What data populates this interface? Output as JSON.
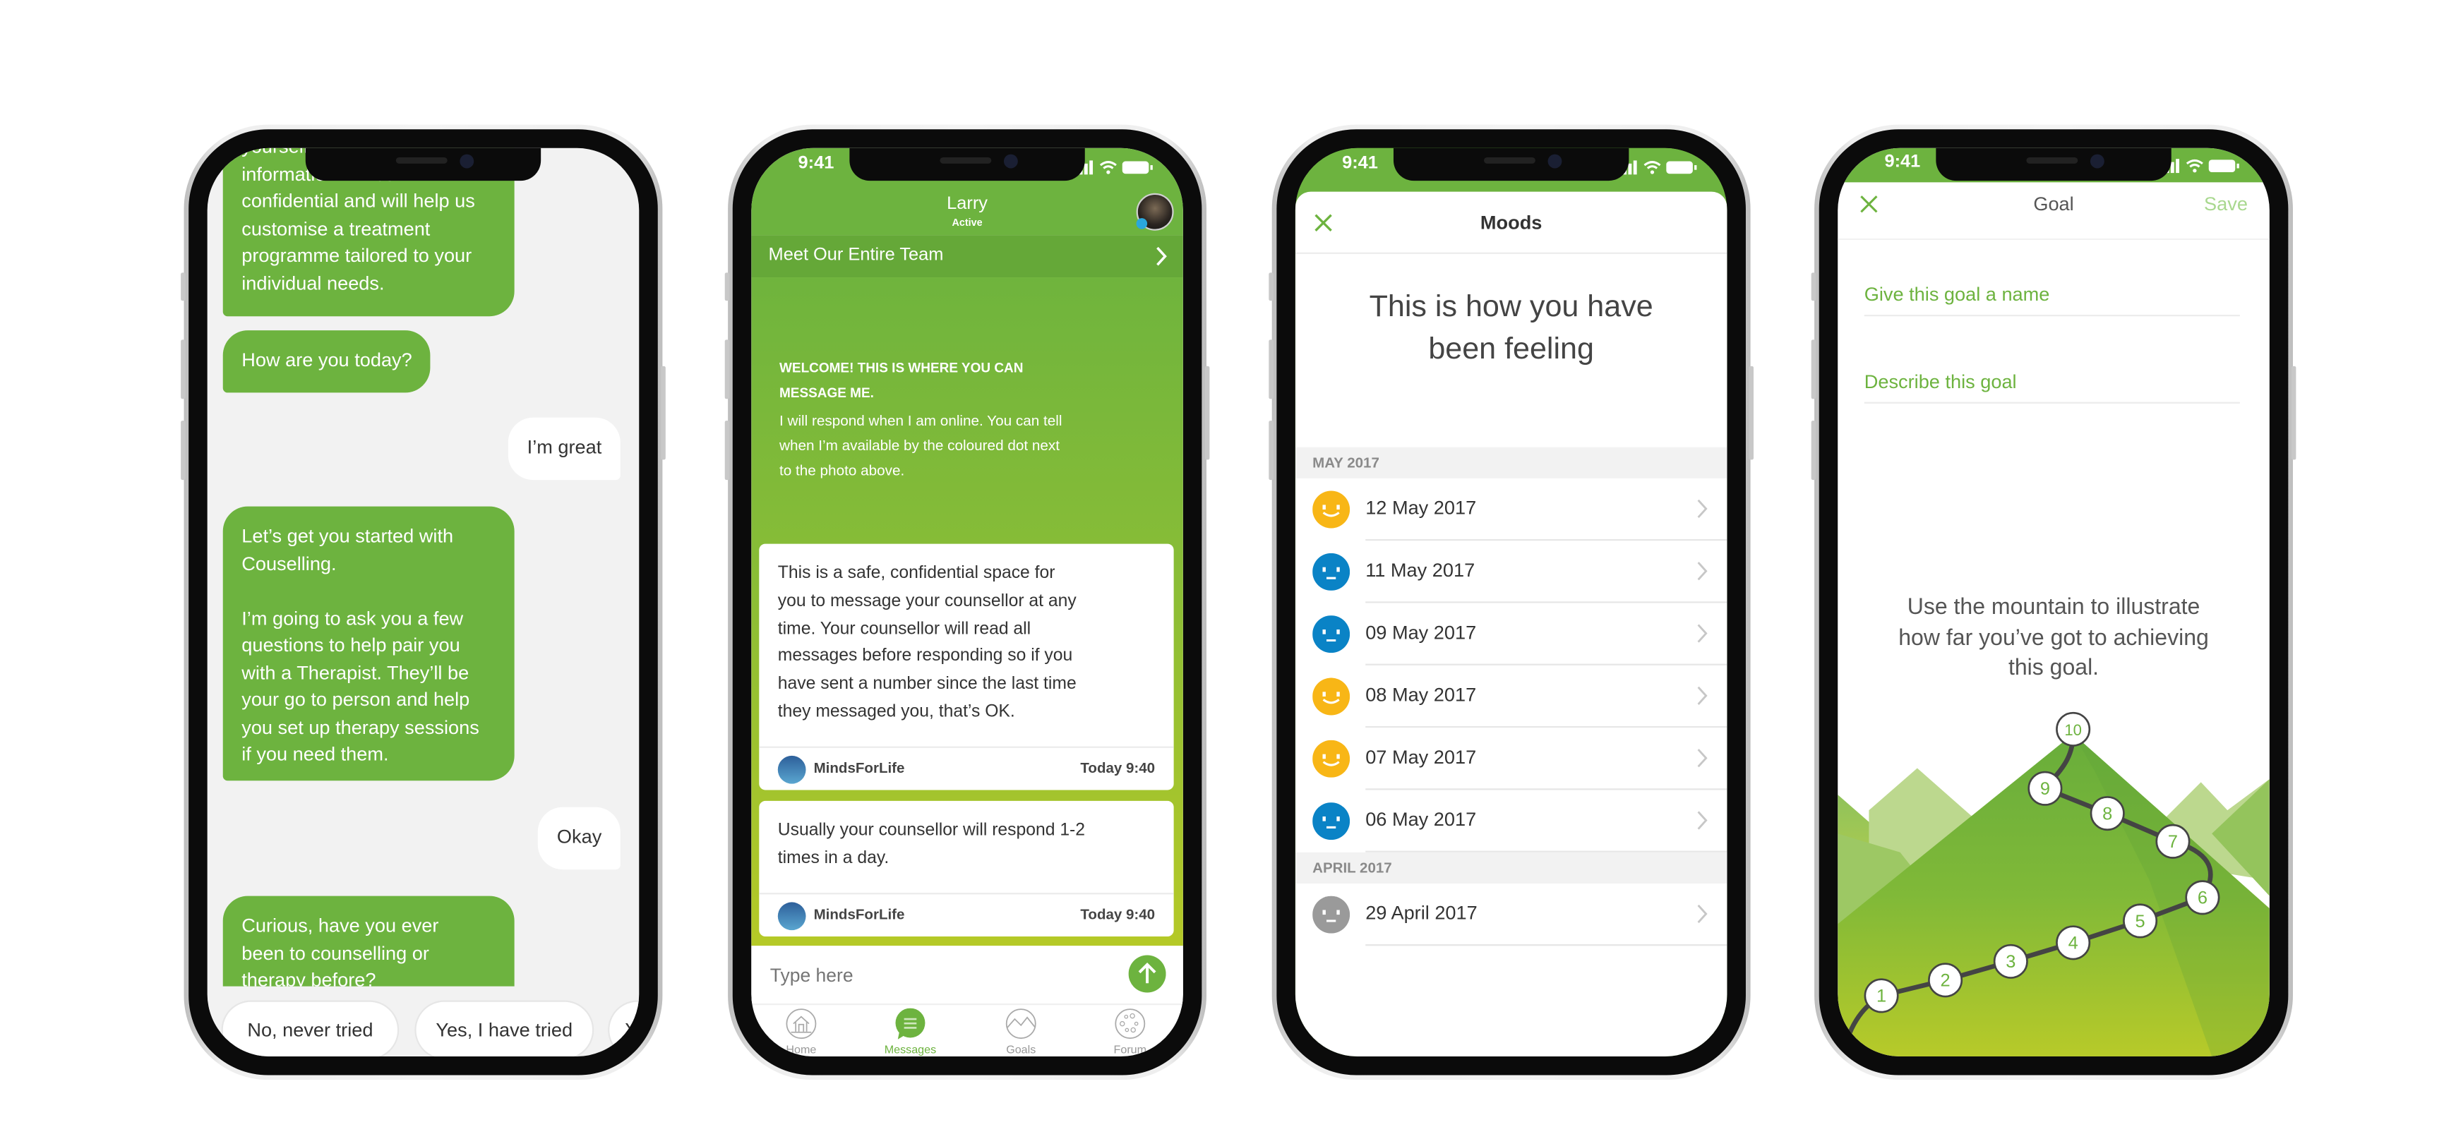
{
  "status_time": "9:41",
  "colors": {
    "brand_green": "#6db33f",
    "happy": "#f8b616",
    "neutral": "#0a83c6",
    "unknown": "#9a9a9a",
    "save_disabled": "#a9d88f"
  },
  "chat": {
    "messages": [
      {
        "from": "bot",
        "text": "yourself\ninformation will be\nconfidential and will help us\ncustomise a treatment\nprogramme tailored to your\nindividual needs."
      },
      {
        "from": "bot",
        "text": "How are you today?"
      },
      {
        "from": "user",
        "text": "I’m great"
      },
      {
        "from": "bot",
        "text": "Let’s get you started with\nCouselling.\n\nI’m going to ask you a few\nquestions to help pair you\nwith a Therapist. They’ll be\nyour go to person and help\nyou set up therapy sessions\nif you need them."
      },
      {
        "from": "user",
        "text": "Okay"
      },
      {
        "from": "bot",
        "text": "Curious, have you ever\nbeen to counselling or\ntherapy before?"
      }
    ],
    "quick_replies": [
      "No, never tried",
      "Yes, I have tried",
      "Y"
    ]
  },
  "messages_screen": {
    "contact_name": "Larry",
    "contact_status": "Active",
    "team_link": "Meet Our Entire Team",
    "welcome_title": "WELCOME! THIS IS WHERE YOU CAN\nMESSAGE ME.",
    "welcome_body": "I will respond when I am online. You can tell\nwhen I’m available by the coloured dot next\nto the photo above.",
    "cards": [
      {
        "text": "This is a safe, confidential space for\nyou to message your counsellor at any\ntime. Your counsellor will read all\nmessages before responding so if you\nhave sent a number since the last time\nthey messaged you, that’s OK.",
        "sender": "MindsForLife",
        "time": "Today 9:40"
      },
      {
        "text": "Usually your counsellor will respond 1-2\ntimes in a day.",
        "sender": "MindsForLife",
        "time": "Today 9:40"
      }
    ],
    "input_placeholder": "Type here",
    "tabs": [
      {
        "label": "Home",
        "icon": "home-icon",
        "active": false
      },
      {
        "label": "Messages",
        "icon": "messages-icon",
        "active": true
      },
      {
        "label": "Goals",
        "icon": "goals-icon",
        "active": false
      },
      {
        "label": "Forum",
        "icon": "forum-icon",
        "active": false
      }
    ]
  },
  "moods": {
    "title": "Moods",
    "heading": "This is how you have\nbeen feeling",
    "sections": [
      {
        "label": "MAY 2017",
        "entries": [
          {
            "date": "12 May 2017",
            "mood": "happy"
          },
          {
            "date": "11 May 2017",
            "mood": "neutral"
          },
          {
            "date": "09 May 2017",
            "mood": "neutral"
          },
          {
            "date": "08 May 2017",
            "mood": "happy"
          },
          {
            "date": "07 May 2017",
            "mood": "happy"
          },
          {
            "date": "06 May 2017",
            "mood": "neutral"
          }
        ]
      },
      {
        "label": "APRIL 2017",
        "entries": [
          {
            "date": "29 April 2017",
            "mood": "unknown"
          }
        ]
      }
    ]
  },
  "goal": {
    "title": "Goal",
    "save_label": "Save",
    "name_placeholder": "Give this goal a name",
    "description_placeholder": "Describe this goal",
    "instruction": "Use the mountain to illustrate\nhow far you’ve got to achieving\nthis goal.",
    "milestones": [
      "1",
      "2",
      "3",
      "4",
      "5",
      "6",
      "7",
      "8",
      "9",
      "10"
    ]
  }
}
